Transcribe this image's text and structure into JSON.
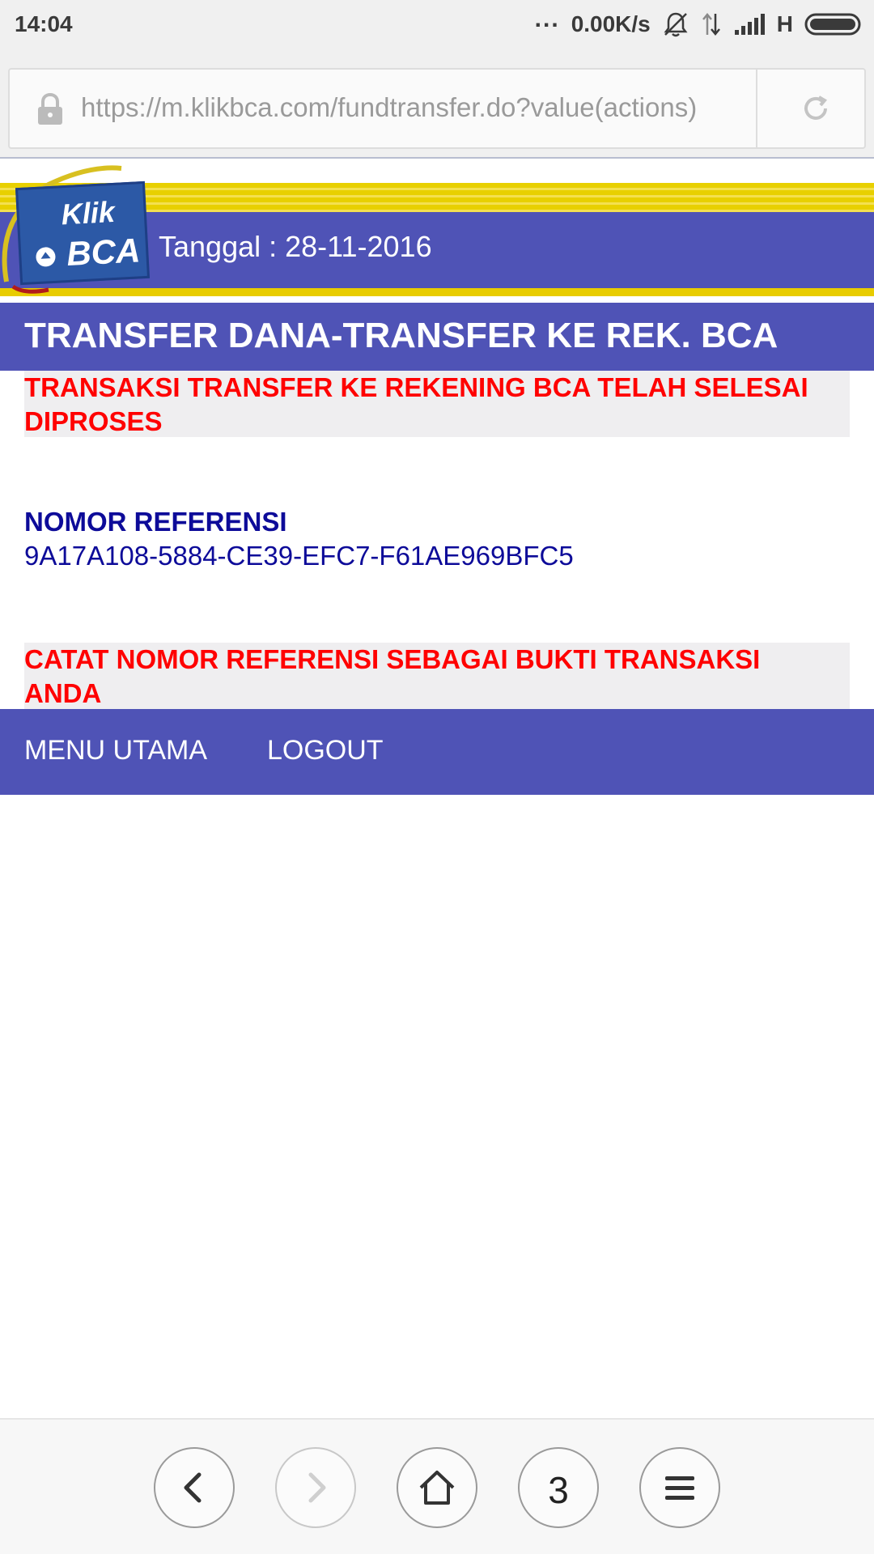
{
  "status_bar": {
    "time": "14:04",
    "dots": "...",
    "speed": "0.00K/s",
    "network_type": "H",
    "icons": [
      "mute-bell-icon",
      "data-transfer-icon",
      "signal-icon",
      "battery-icon"
    ]
  },
  "browser": {
    "url": "https://m.klikbca.com/fundtransfer.do?value(actions)",
    "tab_count": "3",
    "icons": [
      "lock-icon",
      "refresh-icon",
      "back-icon",
      "forward-icon",
      "home-icon",
      "menu-icon"
    ]
  },
  "header": {
    "logo_text": [
      "Klik",
      "BCA"
    ],
    "date_line": "Tanggal : 28-11-2016"
  },
  "page": {
    "title": "TRANSFER DANA-TRANSFER KE REK. BCA",
    "success_message": "TRANSAKSI TRANSFER KE REKENING BCA TELAH SELESAI DIPROSES",
    "reference_label": "NOMOR REFERENSI",
    "reference_number": "9A17A108-5884-CE39-EFC7-F61AE969BFC5",
    "note_message": "CATAT NOMOR REFERENSI SEBAGAI BUKTI TRANSAKSI ANDA"
  },
  "nav": {
    "menu_label": "MENU UTAMA",
    "logout_label": "LOGOUT"
  },
  "colors": {
    "header_blue": "#4f53b6",
    "accent_yellow": "#e8d000",
    "alert_red": "#ff0000",
    "reference_navy": "#0d0b99"
  }
}
